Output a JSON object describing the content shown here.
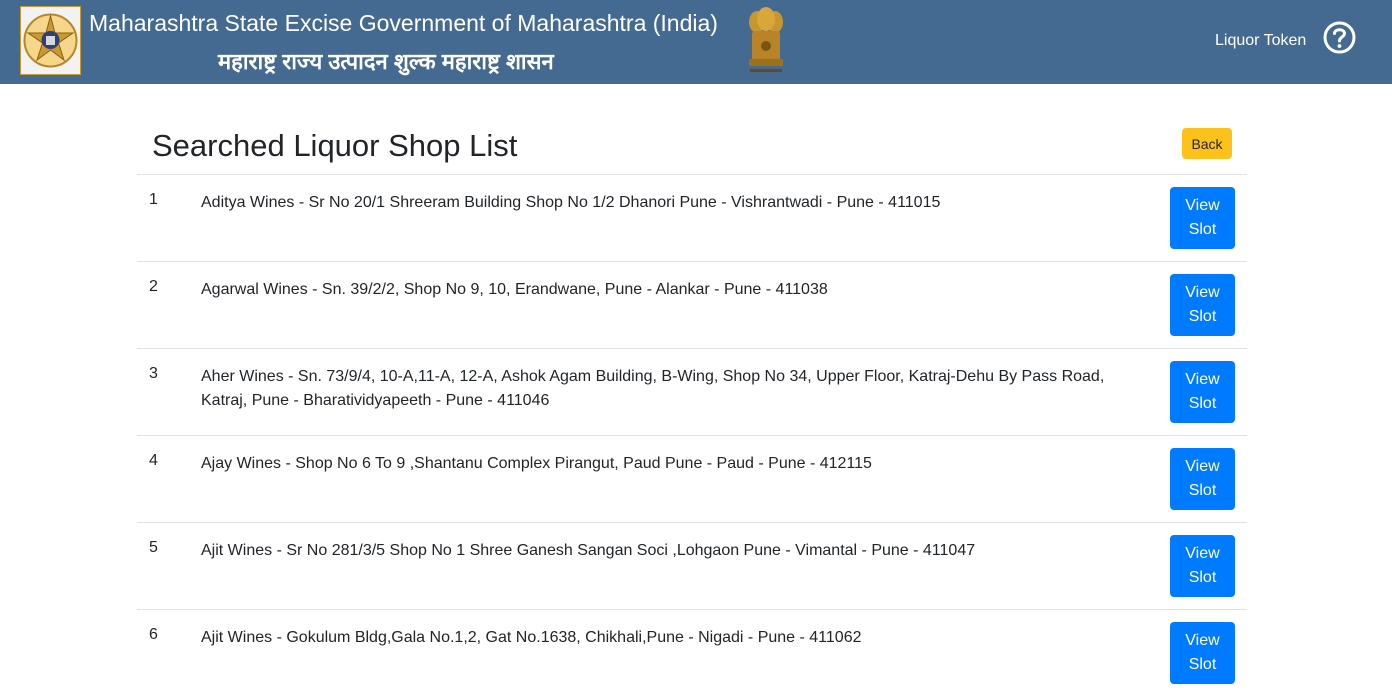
{
  "header": {
    "title_en": "Maharashtra State Excise Government of Maharashtra (India)",
    "title_mr": "महाराष्ट्र राज्य उत्पादन शुल्क महाराष्ट्र शासन",
    "nav_link": "Liquor Token",
    "logo_icon": "excise-department-logo",
    "emblem_icon": "national-emblem",
    "help_icon": "question-circle-icon",
    "bg_color": "#446a91"
  },
  "main": {
    "title": "Searched Liquor Shop List",
    "back_label": "Back",
    "back_color": "#fcc21b",
    "view_color": "#007bff"
  },
  "shops": [
    {
      "num": "1",
      "text": "Aditya Wines - Sr No 20/1 Shreeram Building Shop No 1/2 Dhanori Pune - Vishrantwadi - Pune - 411015",
      "btn_line1": "View",
      "btn_line2": "Slot"
    },
    {
      "num": "2",
      "text": "Agarwal Wines - Sn. 39/2/2, Shop No 9, 10, Erandwane, Pune - Alankar - Pune - 411038",
      "btn_line1": "View",
      "btn_line2": "Slot"
    },
    {
      "num": "3",
      "text": "Aher Wines - Sn. 73/9/4, 10-A,11-A, 12-A, Ashok Agam Building, B-Wing, Shop No 34, Upper Floor, Katraj-Dehu By Pass Road, Katraj, Pune - Bharatividyapeeth - Pune - 411046",
      "btn_line1": "View",
      "btn_line2": "Slot"
    },
    {
      "num": "4",
      "text": "Ajay Wines - Shop No 6 To 9 ,Shantanu Complex Pirangut, Paud Pune - Paud - Pune - 412115",
      "btn_line1": "View",
      "btn_line2": "Slot"
    },
    {
      "num": "5",
      "text": "Ajit Wines - Sr No 281/3/5 Shop No 1 Shree Ganesh Sangan Soci ,Lohgaon Pune - Vimantal - Pune - 411047",
      "btn_line1": "View",
      "btn_line2": "Slot"
    },
    {
      "num": "6",
      "text": "Ajit Wines - Gokulum Bldg,Gala No.1,2, Gat No.1638, Chikhali,Pune - Nigadi - Pune - 411062",
      "btn_line1": "View",
      "btn_line2": "Slot"
    }
  ]
}
